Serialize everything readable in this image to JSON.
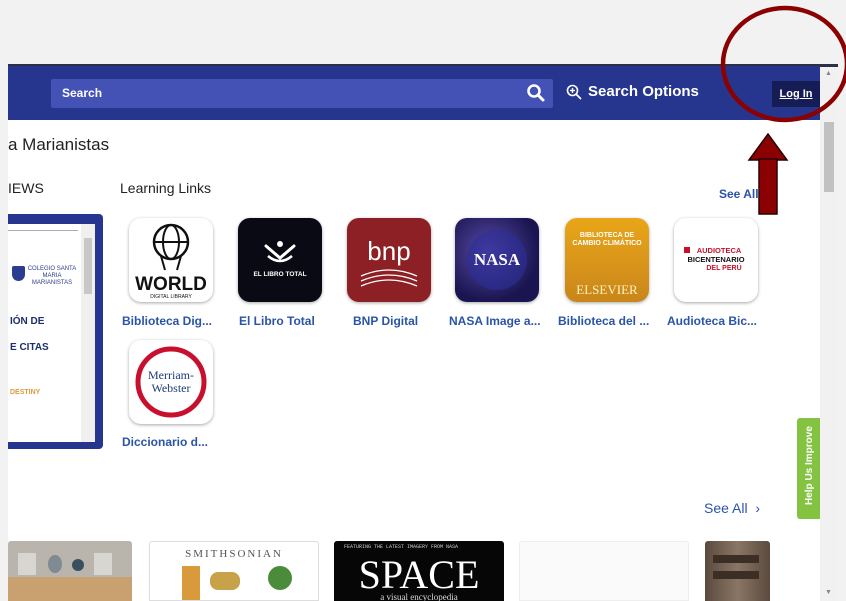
{
  "header": {
    "search_placeholder": "Search",
    "search_options_label": "Search Options",
    "login_label": "Log In"
  },
  "school_title": "a Marianistas",
  "sections": {
    "news_label": "IEWS",
    "learning_links_label": "Learning Links",
    "see_all_top": "See All",
    "see_all_bottom": "See All"
  },
  "news_card": {
    "school_name": "COLEGIO SANTA MARIA MARIANISTAS",
    "heading_1": "IÓN DE",
    "heading_2": "E CITAS",
    "footer": "DESTINY"
  },
  "learning_links": [
    {
      "label": "Biblioteca Dig...",
      "tile_text": "WORLD",
      "tile_sub": "DIGITAL LIBRARY"
    },
    {
      "label": "El Libro Total",
      "tile_text": "EL LIBRO TOTAL"
    },
    {
      "label": "BNP Digital",
      "tile_text": "bnp"
    },
    {
      "label": "NASA Image a...",
      "tile_text": "NASA"
    },
    {
      "label": "Biblioteca del ...",
      "tile_text": "BIBLIOTECA DE CAMBIO CLIMÁTICO",
      "tile_sub": "ELSEVIER"
    },
    {
      "label": "Audioteca Bic...",
      "tile_text": "AUDIOTECA BICENTENARIO",
      "tile_sub": "DEL PERÚ"
    },
    {
      "label": "Diccionario d...",
      "tile_text": "Merriam-Webster"
    }
  ],
  "books": [
    {
      "title_text": ""
    },
    {
      "title_text": "SMITHSONIAN"
    },
    {
      "title_text": "SPACE",
      "tagline": "FEATURING THE LATEST IMAGERY FROM NASA",
      "subtitle": "a visual encyclopedia"
    },
    {
      "title_text": ""
    },
    {
      "title_text": ""
    }
  ],
  "help_tab_label": "Help Us Improve",
  "colors": {
    "header": "#26368f",
    "search_box": "#4452b6",
    "link": "#2a54a8",
    "help_tab": "#84c341",
    "annotation": "#8b0000"
  }
}
